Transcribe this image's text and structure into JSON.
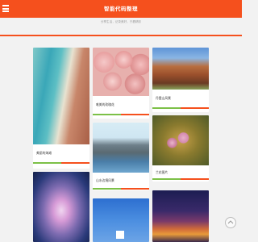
{
  "header": {
    "menu_icon": "hamburger-menu-icon",
    "brand": "智能代码整理",
    "tagline": "分享生活，记录美好，只看精彩",
    "accent_color": "#f5501d"
  },
  "gallery": {
    "cards": [
      {
        "title": "美丽的海滩",
        "image": "beach-shoreline-photo"
      },
      {
        "title": "",
        "image": "jellyfish-photo"
      },
      {
        "title": "唯美的玫瑰花",
        "image": "pink-roses-photo"
      },
      {
        "title": "山水边境风景",
        "image": "waterside-village-photo"
      },
      {
        "title": "",
        "image": "blue-sky-photo"
      },
      {
        "title": "丹霞山风景",
        "image": "red-rock-mountain-photo"
      },
      {
        "title": "兰花图片",
        "image": "orchid-flower-photo"
      },
      {
        "title": "",
        "image": "city-night-lights-photo"
      }
    ],
    "progress_colors": [
      "#7cc047",
      "#f5501d"
    ]
  },
  "back_to_top": {
    "icon": "arrow-up-icon"
  }
}
